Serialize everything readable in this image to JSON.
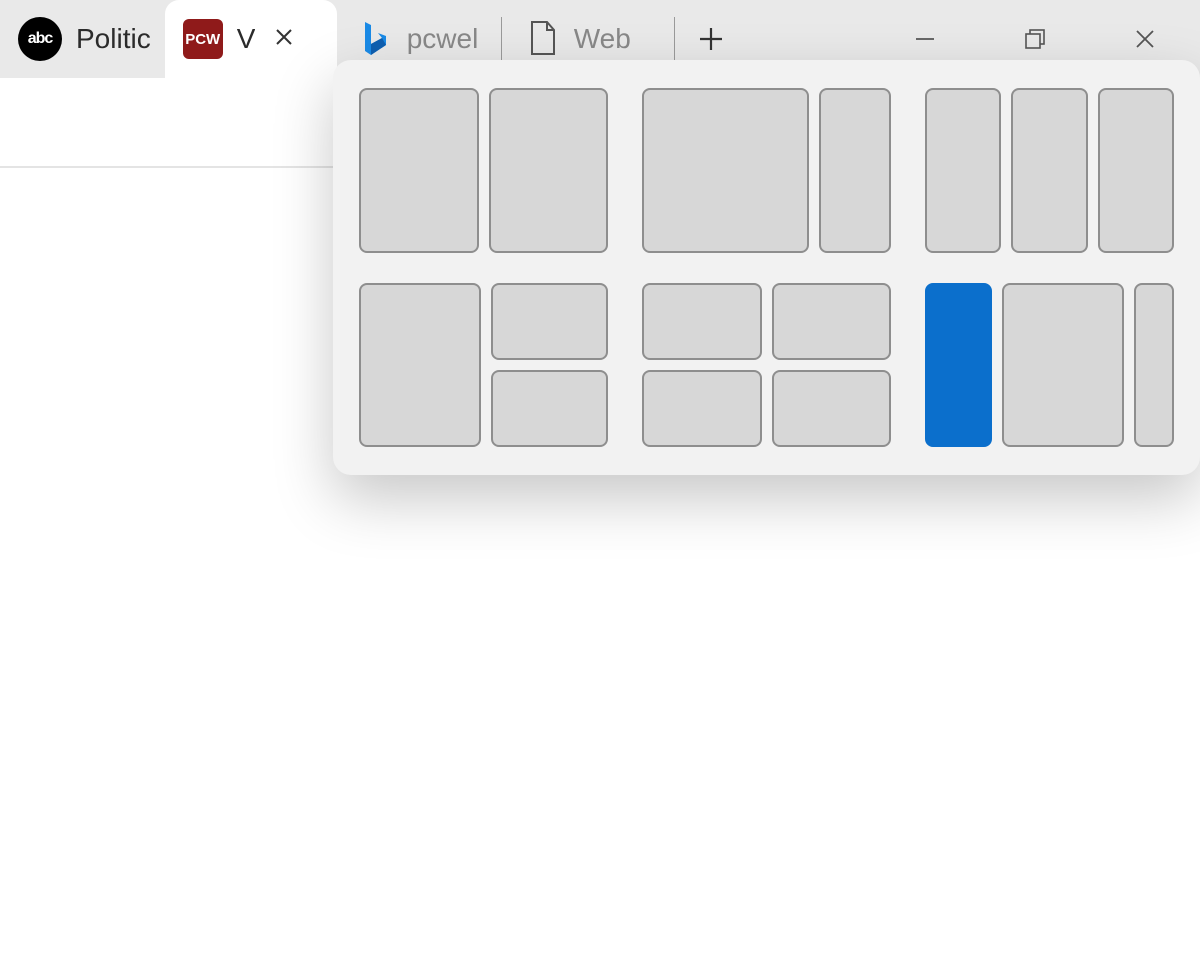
{
  "tabs": [
    {
      "label": "Politic",
      "favicon": "abc"
    },
    {
      "label": "V",
      "favicon": "pcw",
      "active": true,
      "closable": true
    },
    {
      "label": "pcwel",
      "favicon": "bing",
      "faded": true
    },
    {
      "label": "Web",
      "favicon": "page",
      "faded": true
    }
  ],
  "favicon_text": {
    "abc": "abc",
    "pcw": "PCW"
  },
  "snap_layouts": [
    {
      "id": "two-halves",
      "zones": 2
    },
    {
      "id": "wide-narrow",
      "zones": 2
    },
    {
      "id": "three-columns",
      "zones": 3
    },
    {
      "id": "left-plus-stack",
      "zones": 3
    },
    {
      "id": "two-by-two",
      "zones": 4
    },
    {
      "id": "narrow-wide-narrow",
      "zones": 3,
      "selected_zone": 0
    }
  ],
  "colors": {
    "accent": "#0b6fcc",
    "zone_fill": "#d7d7d7",
    "zone_border": "#8e8e8e",
    "flyout_bg": "#f2f2f2",
    "titlebar_bg": "#e9e9e9"
  }
}
